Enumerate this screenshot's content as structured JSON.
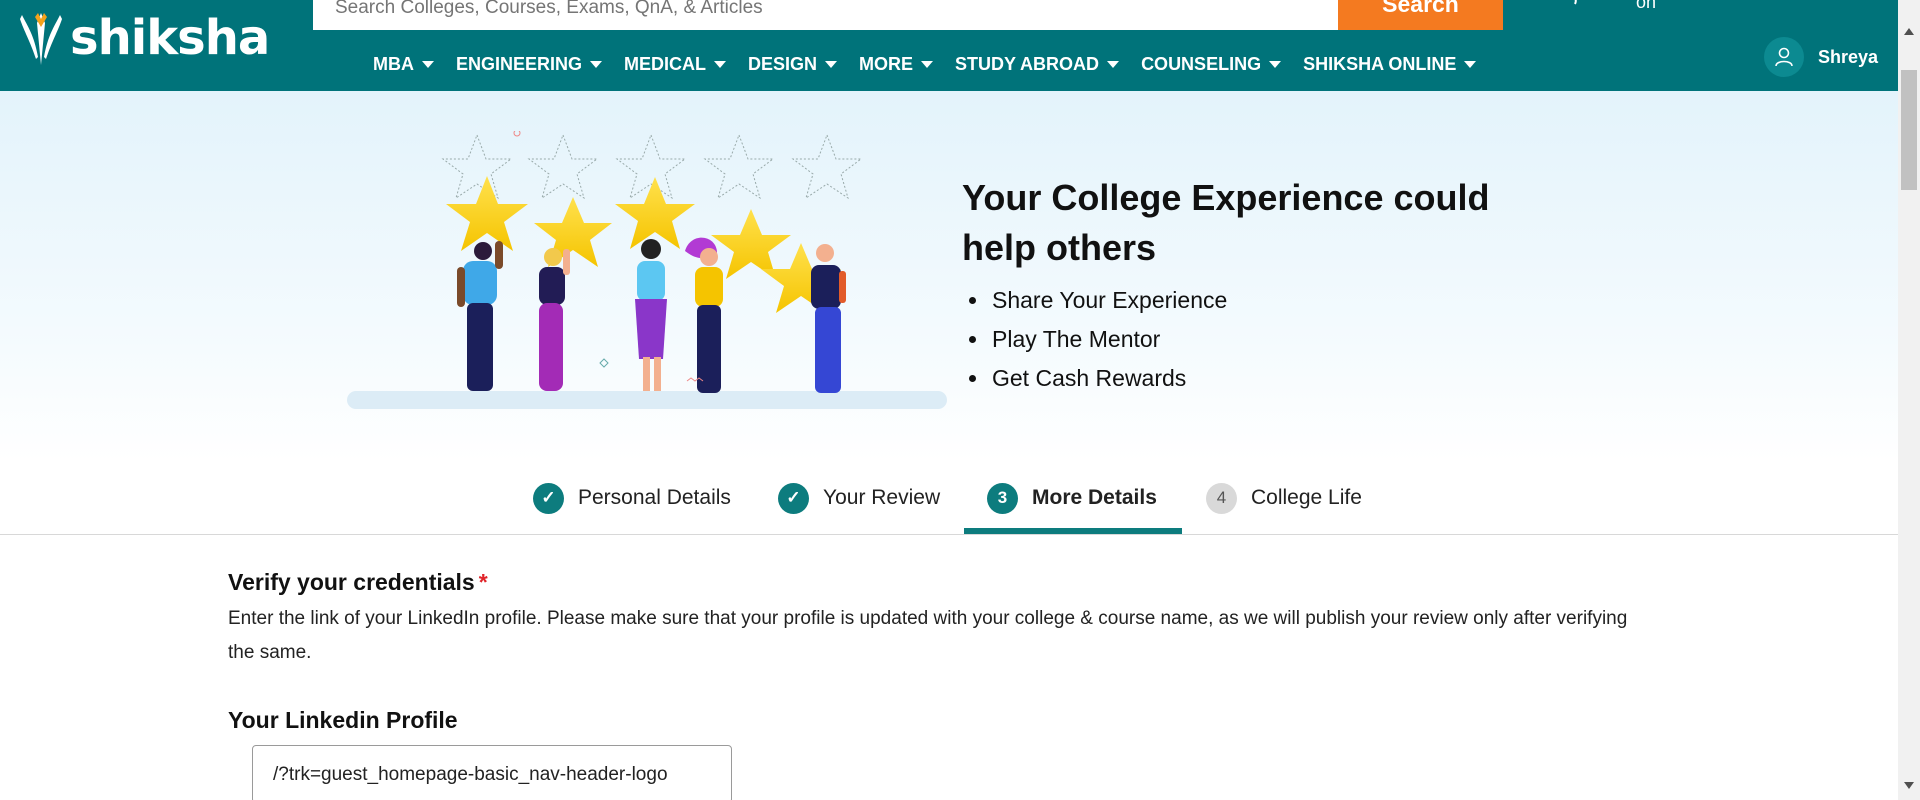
{
  "header": {
    "logo_text": "shiksha",
    "search_placeholder": "Search Colleges, Courses, Exams, QnA, & Articles",
    "search_button": "Search",
    "misc_text": "on",
    "nav": [
      {
        "label": "MBA"
      },
      {
        "label": "ENGINEERING"
      },
      {
        "label": "MEDICAL"
      },
      {
        "label": "DESIGN"
      },
      {
        "label": "MORE"
      },
      {
        "label": "STUDY ABROAD"
      },
      {
        "label": "COUNSELING"
      },
      {
        "label": "SHIKSHA ONLINE"
      }
    ],
    "user_name": "Shreya"
  },
  "hero": {
    "title": "Your College Experience could help others",
    "bullets": [
      "Share Your Experience",
      "Play The Mentor",
      "Get Cash Rewards"
    ]
  },
  "steps": [
    {
      "number": "✓",
      "label": "Personal Details",
      "status": "done"
    },
    {
      "number": "✓",
      "label": "Your Review",
      "status": "done"
    },
    {
      "number": "3",
      "label": "More Details",
      "status": "active"
    },
    {
      "number": "4",
      "label": "College Life",
      "status": "pending"
    }
  ],
  "form": {
    "cred_title": "Verify your credentials",
    "required_mark": "*",
    "cred_desc": "Enter the link of your LinkedIn profile. Please make sure that your profile is updated with your college & course name, as we will publish your review only after verifying the same.",
    "linkedin_label": "Your Linkedin Profile",
    "linkedin_value": "/?trk=guest_homepage-basic_nav-header-logo"
  },
  "colors": {
    "header": "#00737a",
    "accent": "#0d7c7e",
    "search_button": "#f47a20",
    "required": "#e0242a"
  }
}
